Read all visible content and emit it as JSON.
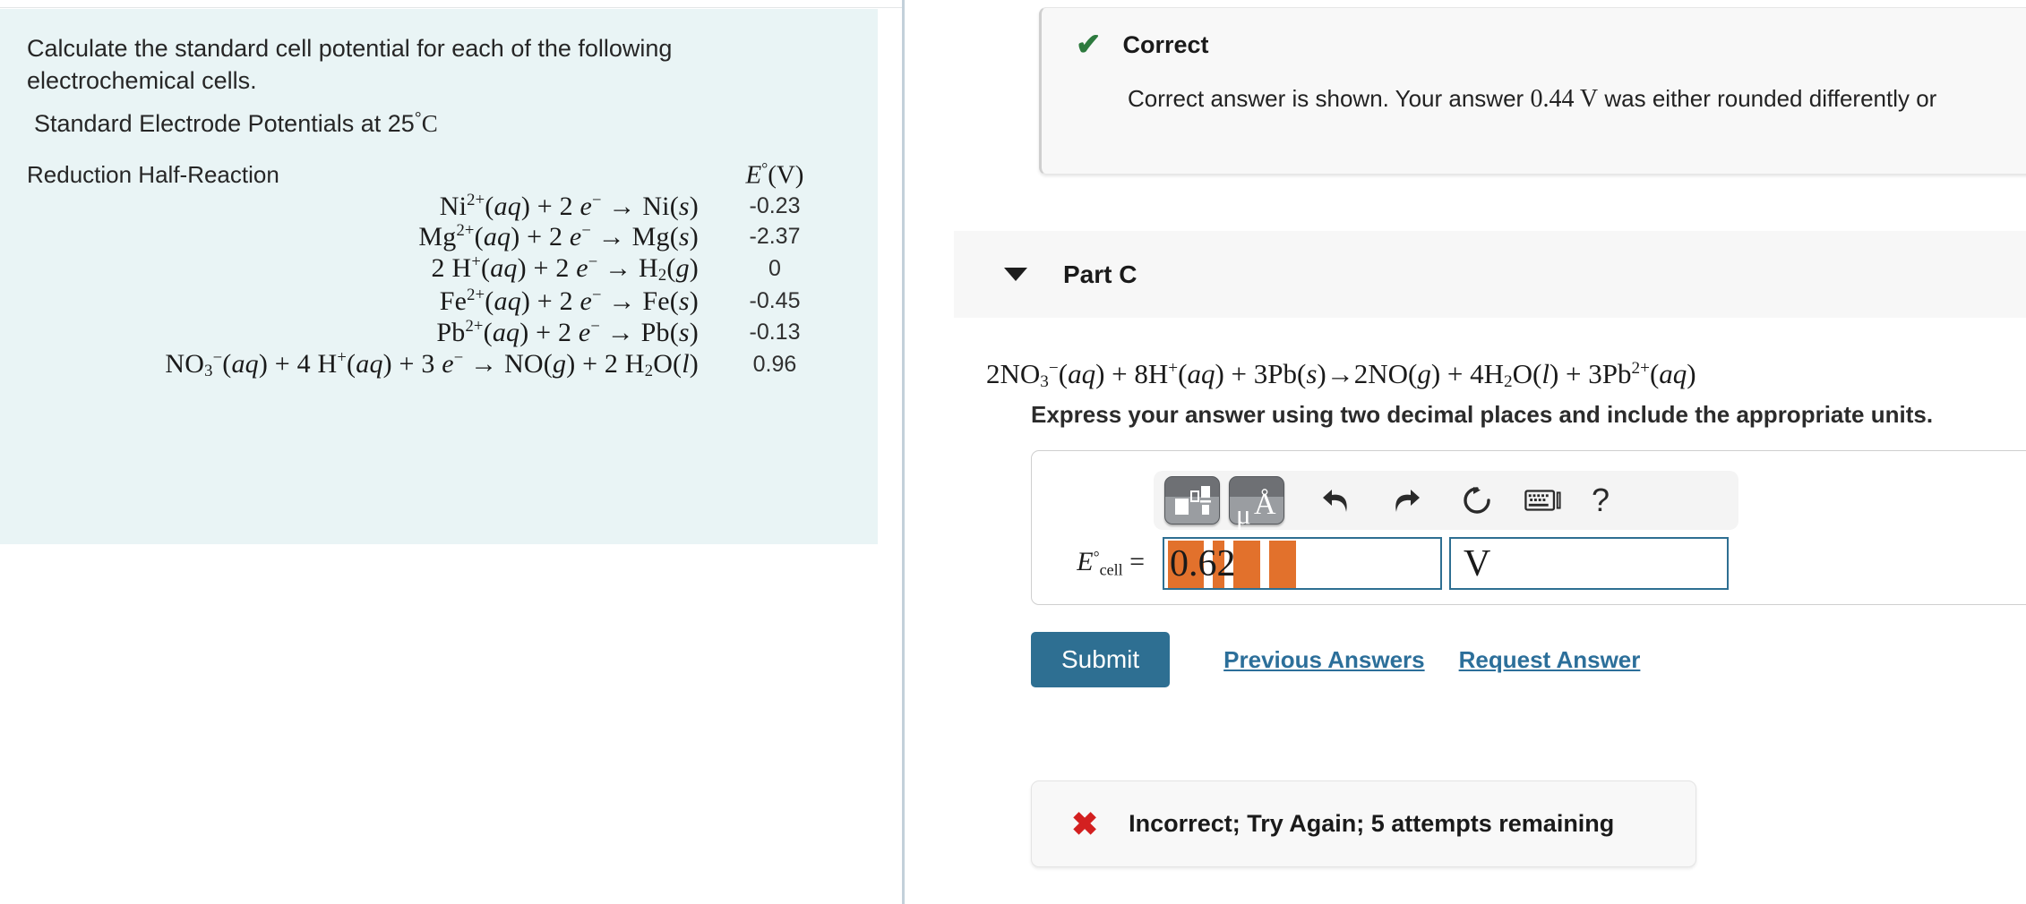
{
  "left_panel": {
    "problem_statement": "Calculate the standard cell potential for each of the following electrochemical cells.",
    "table_title_prefix": "Standard Electrode Potentials at 25",
    "table_title_deg": "°",
    "table_title_unit": "C",
    "columns": {
      "reaction_header": "Reduction Half-Reaction",
      "value_header_E": "E",
      "value_header_deg": "°",
      "value_header_unit": "(V)"
    },
    "rows": [
      {
        "reaction_html": "Ni<sup>2+</sup>(<i>aq</i>) + 2 <i>e</i><sup>−</sup> → Ni(<i>s</i>)",
        "value": "-0.23"
      },
      {
        "reaction_html": "Mg<sup>2+</sup>(<i>aq</i>) + 2 <i>e</i><sup>−</sup> → Mg(<i>s</i>)",
        "value": "-2.37"
      },
      {
        "reaction_html": "2 H<sup>+</sup>(<i>aq</i>) + 2 <i>e</i><sup>−</sup> → H<sub>2</sub>(<i>g</i>)",
        "value": "0"
      },
      {
        "reaction_html": "Fe<sup>2+</sup>(<i>aq</i>) + 2 <i>e</i><sup>−</sup> → Fe(<i>s</i>)",
        "value": "-0.45"
      },
      {
        "reaction_html": "Pb<sup>2+</sup>(<i>aq</i>) + 2 <i>e</i><sup>−</sup> → Pb(<i>s</i>)",
        "value": "-0.13"
      },
      {
        "reaction_html": "NO<sub>3</sub><sup>−</sup>(<i>aq</i>) + 4 H<sup>+</sup>(<i>aq</i>) + 3 <i>e</i><sup>−</sup> → NO(<i>g</i>) + 2 H<sub>2</sub>O(<i>l</i>)",
        "value": "0.96"
      }
    ]
  },
  "right_panel": {
    "correct_feedback": {
      "icon": "check-icon",
      "title": "Correct",
      "body_pre": "Correct answer is shown. Your answer ",
      "body_value": "0.44 V",
      "body_post": " was either rounded differently or"
    },
    "part": {
      "caret": "chevron-down-icon",
      "label": "Part C",
      "equation_html": "2NO<sub>3</sub><sup>−</sup>(<i>aq</i>) + 8H<sup>+</sup>(<i>aq</i>) + 3Pb(<i>s</i>)→2NO(<i>g</i>) + 4H<sub>2</sub>O(<i>l</i>) + 3Pb<sup>2+</sup>(<i>aq</i>)",
      "instruction": "Express your answer using two decimal places and include the appropriate units."
    },
    "answer_widget": {
      "toolbar": [
        {
          "name": "template-palette-button",
          "glyph": ""
        },
        {
          "name": "units-palette-button",
          "glyph": "μÅ"
        },
        {
          "name": "undo-icon",
          "glyph": "↶"
        },
        {
          "name": "redo-icon",
          "glyph": "↷"
        },
        {
          "name": "reset-icon",
          "glyph": "↻"
        },
        {
          "name": "keyboard-icon",
          "glyph": "⌨"
        },
        {
          "name": "help-icon",
          "glyph": "?"
        }
      ],
      "label_E": "E",
      "label_deg": "°",
      "label_sub": "cell",
      "label_eq": " =",
      "value": "0.62",
      "unit": "V",
      "selection_color": "#e2712c",
      "field_border_color": "#2e6f92"
    },
    "actions": {
      "submit_label": "Submit",
      "previous_answers_label": "Previous Answers",
      "request_answer_label": "Request Answer",
      "submit_color": "#2e6f92",
      "link_color": "#2c6f9a"
    },
    "incorrect_feedback": {
      "icon": "x-icon",
      "text": "Incorrect; Try Again; 5 attempts remaining",
      "icon_color": "#d32020"
    }
  }
}
